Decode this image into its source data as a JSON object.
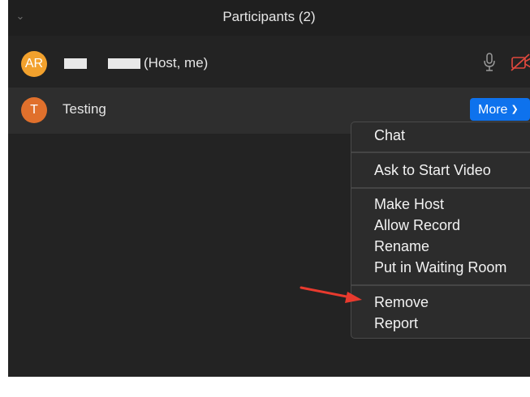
{
  "header": {
    "title": "Participants (2)",
    "collapse_icon": "chevron-down-icon"
  },
  "participants": [
    {
      "initials": "AR",
      "suffix": "(Host, me)",
      "avatar_color": "#f2a12d",
      "mic_icon": "microphone-icon",
      "camera_icon": "video-off-icon",
      "camera_color": "#e0483d"
    },
    {
      "initials": "T",
      "name": "Testing",
      "avatar_color": "#e0702c",
      "more_label": "More",
      "more_color": "#0e72ed"
    }
  ],
  "menu": {
    "items": [
      "Chat",
      "Ask to Start Video",
      "Make Host",
      "Allow Record",
      "Rename",
      "Put in Waiting Room",
      "Remove",
      "Report"
    ]
  },
  "annotation": {
    "arrow_color": "#e83a2e"
  }
}
